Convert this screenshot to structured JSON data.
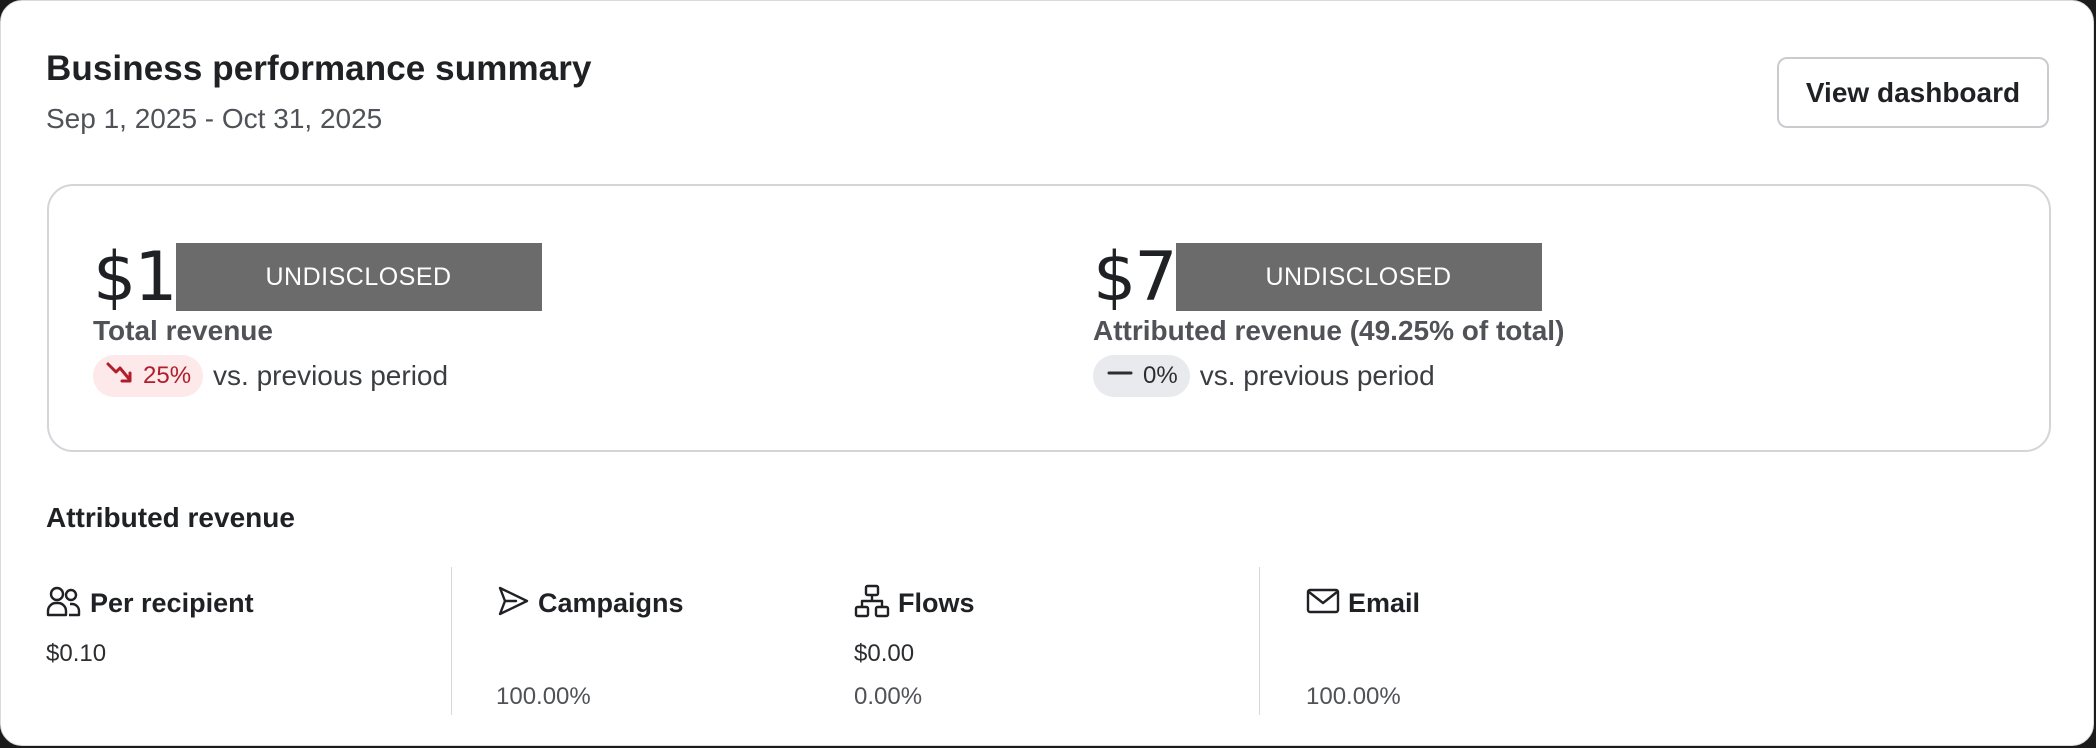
{
  "header": {
    "title": "Business performance summary",
    "date_range": "Sep 1, 2025 - Oct 31, 2025",
    "view_button_label": "View dashboard"
  },
  "kpis": {
    "total": {
      "value_prefix": "$1",
      "redaction_label": "UNDISCLOSED",
      "label": "Total revenue",
      "change": "25%",
      "change_direction": "down",
      "comparison_text": "vs. previous period"
    },
    "attributed": {
      "value_prefix": "$7",
      "redaction_label": "UNDISCLOSED",
      "label": "Attributed revenue (49.25% of total)",
      "change": "0%",
      "change_direction": "flat",
      "comparison_text": "vs. previous period"
    }
  },
  "attributed_section": {
    "title": "Attributed revenue",
    "per_recipient": {
      "label": "Per recipient",
      "value": "$0.10",
      "icon": "users-icon"
    },
    "campaigns": {
      "label": "Campaigns",
      "value": "",
      "percent": "100.00%",
      "icon": "send-icon"
    },
    "flows": {
      "label": "Flows",
      "value": "$0.00",
      "percent": "0.00%",
      "icon": "flow-icon"
    },
    "email": {
      "label": "Email",
      "value": "",
      "percent": "100.00%",
      "icon": "mail-icon"
    }
  },
  "colors": {
    "down_pill_bg": "#fde8ea",
    "down_text": "#b11d2b",
    "flat_pill_bg": "#e8eaed",
    "redaction": "#6b6b6b"
  }
}
